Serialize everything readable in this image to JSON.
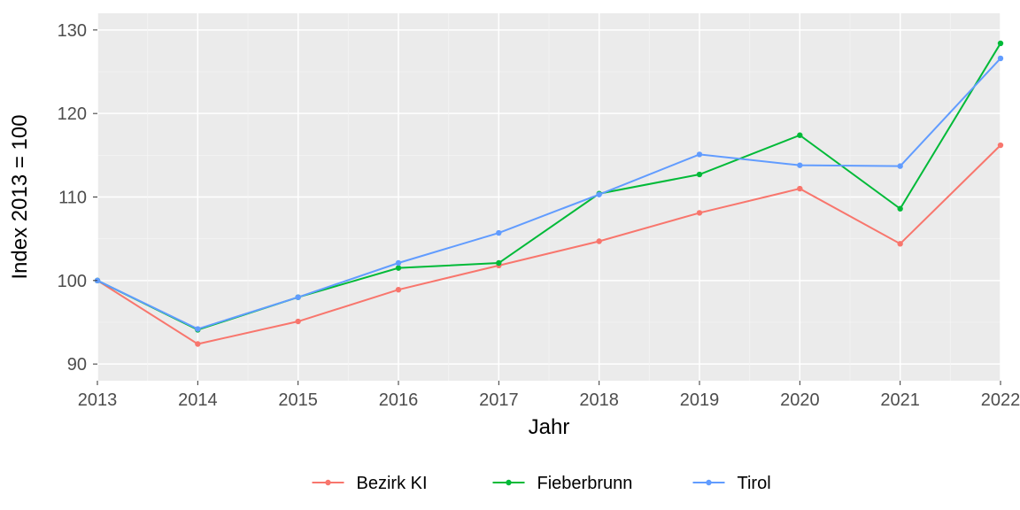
{
  "chart_data": {
    "type": "line",
    "title": "",
    "xlabel": "Jahr",
    "ylabel": "Index  2013  = 100",
    "categories": [
      "2013",
      "2014",
      "2015",
      "2016",
      "2017",
      "2018",
      "2019",
      "2020",
      "2021",
      "2022"
    ],
    "ylim": [
      88,
      132
    ],
    "y_ticks": [
      90,
      100,
      110,
      120,
      130
    ],
    "series": [
      {
        "name": "Bezirk KI",
        "color": "#F8766D",
        "values": [
          100.0,
          92.4,
          95.1,
          98.9,
          101.8,
          104.7,
          108.1,
          111.0,
          104.4,
          116.2
        ]
      },
      {
        "name": "Fieberbrunn",
        "color": "#00BA38",
        "values": [
          100.0,
          94.1,
          98.0,
          101.5,
          102.1,
          110.4,
          112.7,
          117.4,
          108.6,
          128.4
        ]
      },
      {
        "name": "Tirol",
        "color": "#619CFF",
        "values": [
          100.0,
          94.2,
          98.0,
          102.1,
          105.7,
          110.3,
          115.1,
          113.8,
          113.7,
          126.6
        ]
      }
    ],
    "legend_position": "bottom",
    "grid": true
  }
}
